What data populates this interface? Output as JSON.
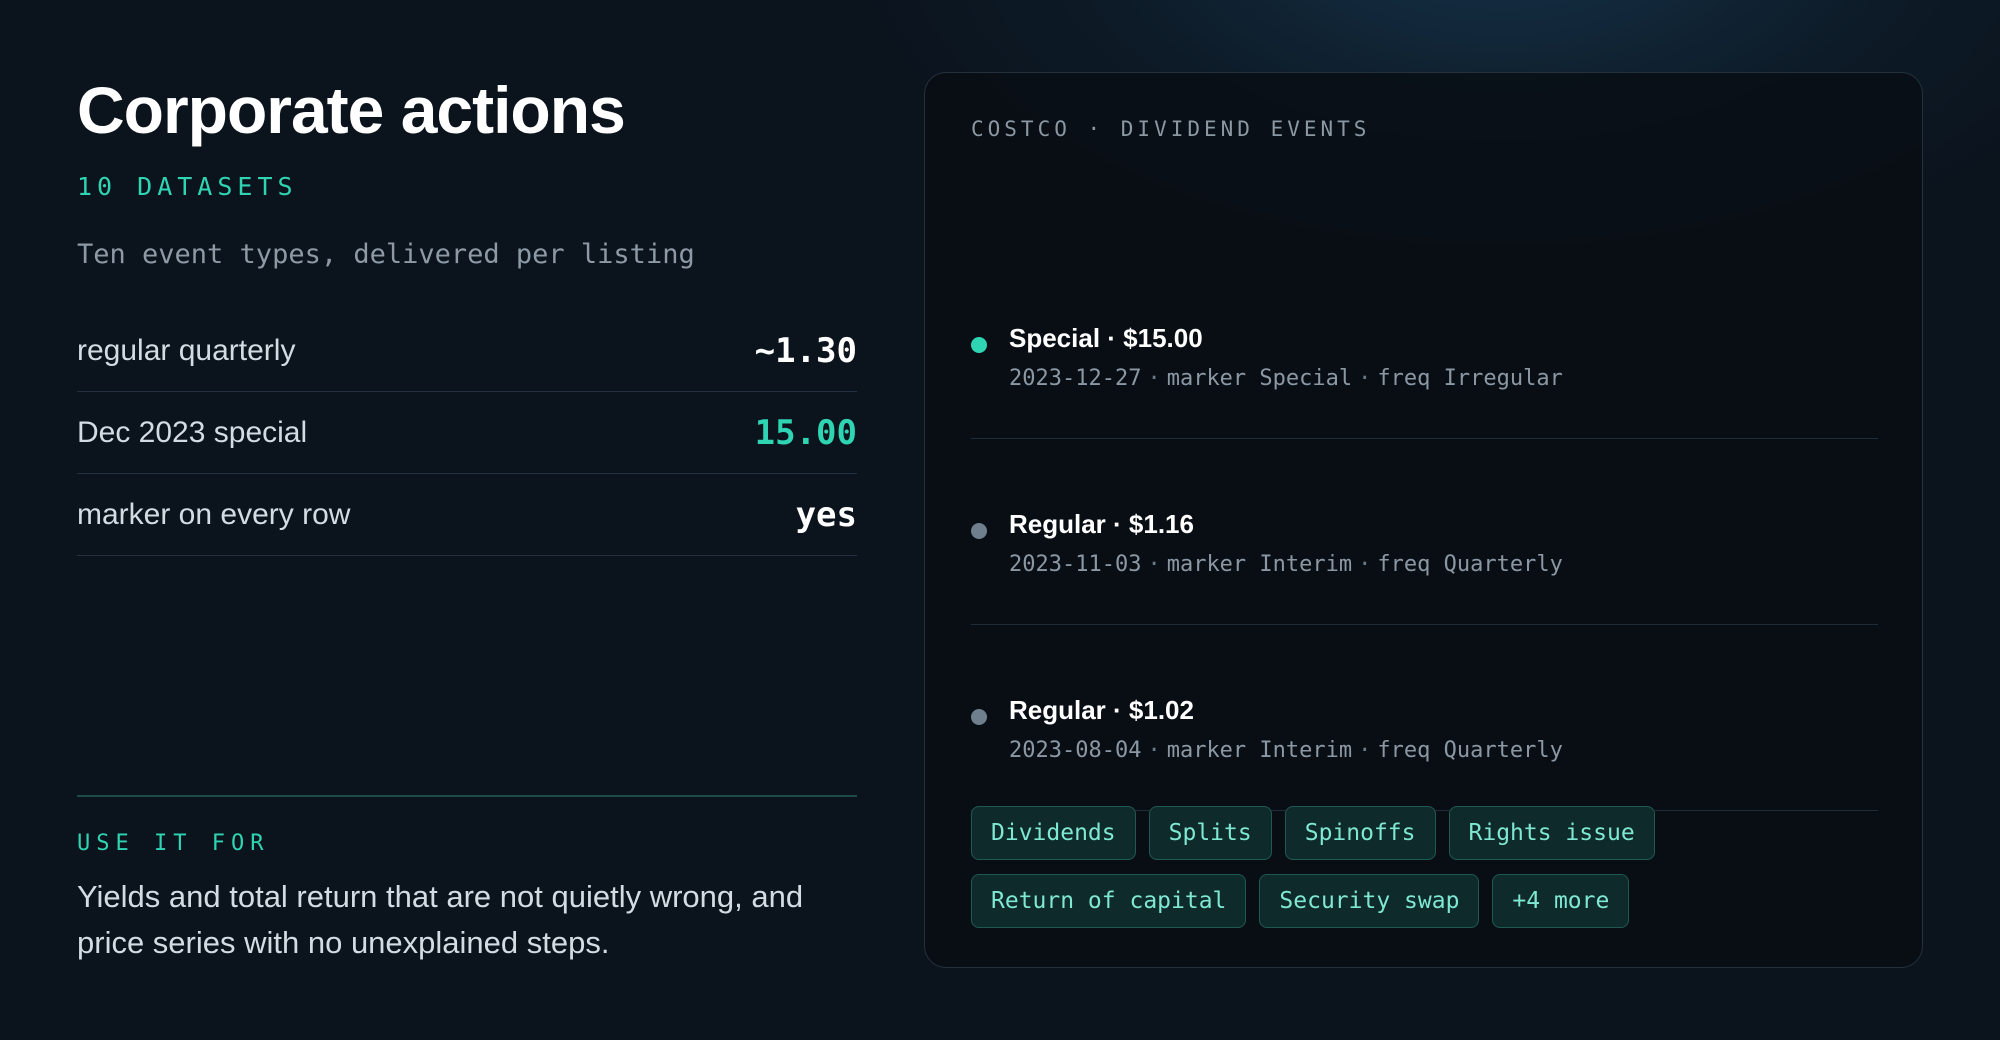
{
  "left": {
    "title": "Corporate actions",
    "subtitle": "10 DATASETS",
    "description": "Ten event types, delivered per listing",
    "stats": [
      {
        "label": "regular quarterly",
        "value": "~1.30",
        "accent": false
      },
      {
        "label": "Dec 2023 special",
        "value": "15.00",
        "accent": true
      },
      {
        "label": "marker on every row",
        "value": "yes",
        "accent": false
      }
    ],
    "use_label": "USE IT FOR",
    "use_text": "Yields and total return that are not quietly wrong, and price series with no unexplained steps."
  },
  "panel": {
    "header": "COSTCO · DIVIDEND EVENTS",
    "events": [
      {
        "title": "Special · $15.00",
        "date": "2023-12-27",
        "marker": "marker Special",
        "freq": "freq Irregular",
        "status": "special"
      },
      {
        "title": "Regular · $1.16",
        "date": "2023-11-03",
        "marker": "marker Interim",
        "freq": "freq Quarterly",
        "status": "regular"
      },
      {
        "title": "Regular · $1.02",
        "date": "2023-08-04",
        "marker": "marker Interim",
        "freq": "freq Quarterly",
        "status": "regular"
      }
    ],
    "tags": [
      "Dividends",
      "Splits",
      "Spinoffs",
      "Rights issue",
      "Return of capital",
      "Security swap",
      "+4 more"
    ]
  },
  "colors": {
    "accent": "#2fd4b3",
    "background": "#0b131c",
    "regular_dot": "#6f7f8e",
    "tag_bg": "#0e2a2b"
  }
}
